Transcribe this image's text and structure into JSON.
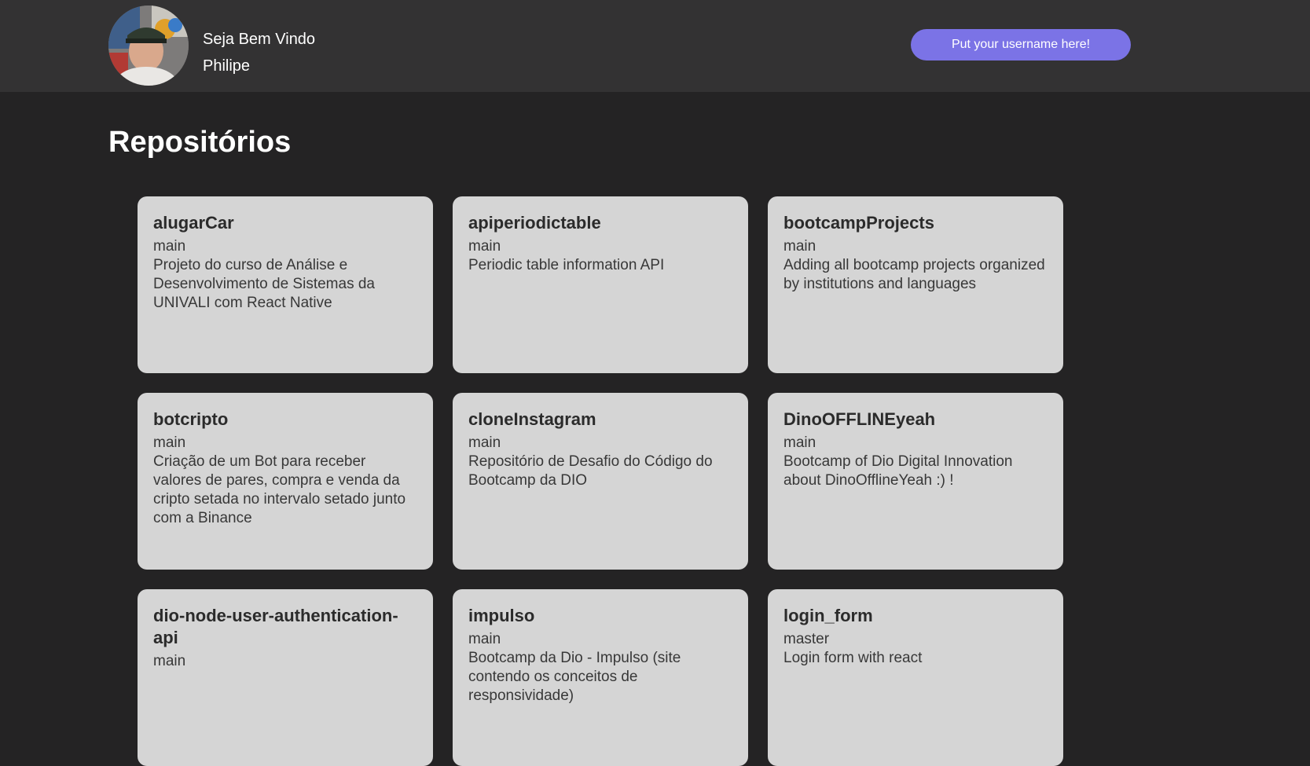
{
  "header": {
    "greeting": "Seja Bem Vindo",
    "user_name": "Philipe",
    "username_placeholder": "Put your username here!"
  },
  "main": {
    "title": "Repositórios",
    "repos": [
      {
        "name": "alugarCar",
        "branch": "main",
        "description": "Projeto do curso de Análise e Desenvolvimento de Sistemas da UNIVALI com React Native"
      },
      {
        "name": "apiperiodictable",
        "branch": "main",
        "description": "Periodic table information API"
      },
      {
        "name": "bootcampProjects",
        "branch": "main",
        "description": "Adding all bootcamp projects organized by institutions and languages"
      },
      {
        "name": "botcripto",
        "branch": "main",
        "description": "Criação de um Bot para receber valores de pares, compra e venda da cripto setada no intervalo setado junto com a Binance"
      },
      {
        "name": "cloneInstagram",
        "branch": "main",
        "description": "Repositório de Desafio do Código do Bootcamp da DIO"
      },
      {
        "name": "DinoOFFLINEyeah",
        "branch": "main",
        "description": "Bootcamp of Dio Digital Innovation about DinoOfflineYeah :) !"
      },
      {
        "name": "dio-node-user-authentication-api",
        "branch": "main",
        "description": ""
      },
      {
        "name": "impulso",
        "branch": "main",
        "description": "Bootcamp da Dio - Impulso (site contendo os conceitos de responsividade)"
      },
      {
        "name": "login_form",
        "branch": "master",
        "description": "Login form with react"
      }
    ]
  }
}
